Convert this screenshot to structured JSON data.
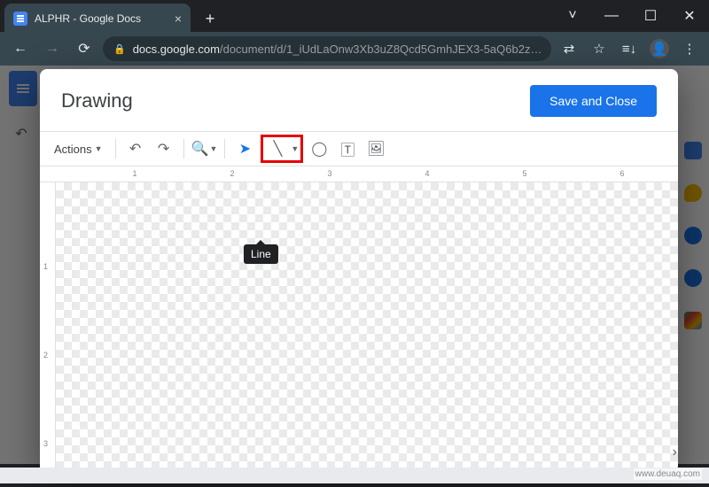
{
  "browser": {
    "tab_title": "ALPHR - Google Docs",
    "url_host": "docs.google.com",
    "url_path": "/document/d/1_iUdLaOnw3Xb3uZ8Qcd5GmhJEX3-5aQ6b2z…",
    "win": {
      "min": "—",
      "max": "☐",
      "close": "✕",
      "restore_down": "˅"
    }
  },
  "side_panel": {
    "items": [
      "calendar",
      "keep",
      "tasks",
      "contacts",
      "maps"
    ]
  },
  "modal": {
    "title": "Drawing",
    "save_label": "Save and Close",
    "toolbar": {
      "actions_label": "Actions",
      "tooltip_line": "Line"
    },
    "ruler": {
      "marks": [
        "1",
        "2",
        "3",
        "4",
        "5",
        "6"
      ]
    },
    "ruler_v": {
      "marks": [
        "1",
        "2",
        "3"
      ]
    }
  },
  "watermark": "www.deuaq.com"
}
